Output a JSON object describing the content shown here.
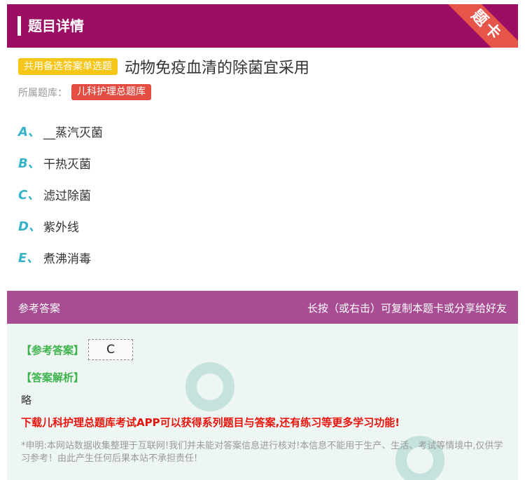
{
  "header": {
    "title": "题目详情",
    "ribbon": "题卡"
  },
  "question": {
    "tag": "共用备选答案单选题",
    "text": "动物免疫血清的除菌宜采用",
    "bank_label": "所属题库：",
    "bank_name": "儿科护理总题库"
  },
  "options": [
    {
      "letter": "A、",
      "text": "__蒸汽灭菌"
    },
    {
      "letter": "B、",
      "text": "干热灭菌"
    },
    {
      "letter": "C、",
      "text": "滤过除菌"
    },
    {
      "letter": "D、",
      "text": "紫外线"
    },
    {
      "letter": "E、",
      "text": "煮沸消毒"
    }
  ],
  "answer_bar": {
    "left": "参考答案",
    "right": "长按（或右击）可复制本题卡或分享给好友"
  },
  "answer": {
    "label": "【参考答案】",
    "value": "C",
    "analysis_label": "【答案解析】",
    "analysis": "略",
    "promo": "下载儿科护理总题库考试APP可以获得系列题目与答案,还有练习等更多学习功能!",
    "disclaimer": "*申明:本网站数据收集整理于互联网!我们并未能对答案信息进行核对!本信息不能用于生产、生活、考试等情境中,仅供学习参考！由此产生任何后果本站不承担责任!"
  },
  "colors": {
    "header_bg": "#9c0e63",
    "ribbon": "#e5554a",
    "tag": "#f5c518",
    "bank_tag": "#e54d42",
    "option_letter": "#35b3c7",
    "answer_bar": "#a84d94",
    "answer_bg": "#eef6f4",
    "green": "#3cb34a",
    "promo": "#e8140c"
  }
}
